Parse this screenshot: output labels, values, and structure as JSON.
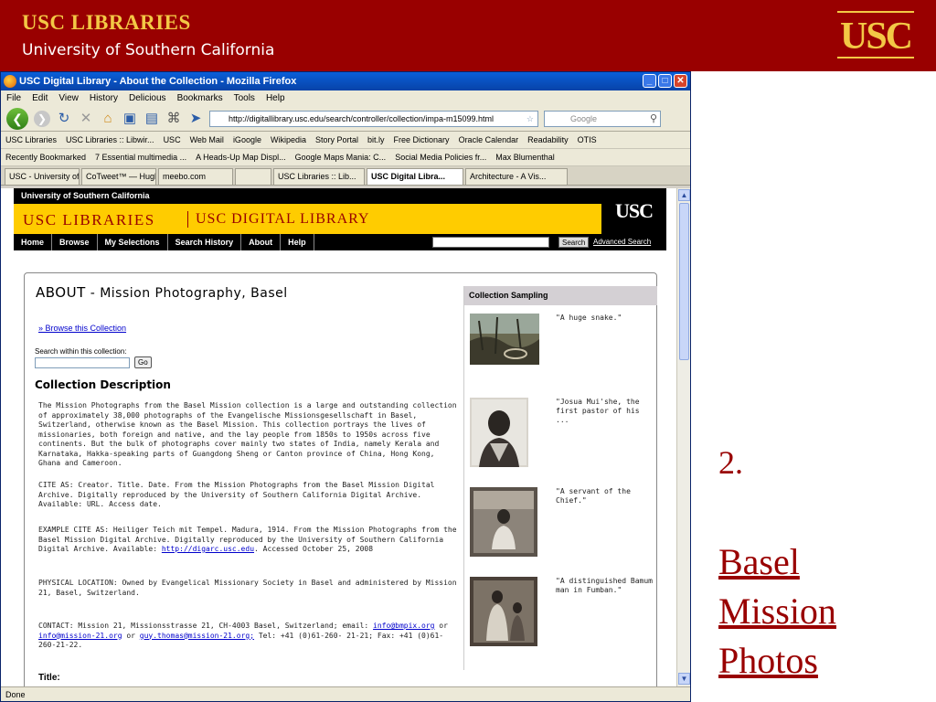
{
  "slide": {
    "brand_line1": "USC LIBRARIES",
    "brand_line2": "University of Southern California",
    "logo_text": "USC",
    "number": "2.",
    "link_lines": [
      "Basel",
      "Mission",
      "Photos"
    ]
  },
  "browser": {
    "title": "USC Digital Library - About the Collection - Mozilla Firefox",
    "menu": [
      "File",
      "Edit",
      "View",
      "History",
      "Delicious",
      "Bookmarks",
      "Tools",
      "Help"
    ],
    "url": "http://digitallibrary.usc.edu/search/controller/collection/impa-m15099.html",
    "search_placeholder": "Google",
    "bookmarks1": [
      "USC Libraries",
      "USC Libraries :: Libwir...",
      "USC",
      "Web Mail",
      "iGoogle",
      "Wikipedia",
      "Story Portal",
      "bit.ly",
      "Free Dictionary",
      "Oracle Calendar",
      "Readability",
      "OTIS"
    ],
    "bookmarks2": [
      "Recently Bookmarked",
      "7 Essential multimedia ...",
      "A Heads-Up Map Displ...",
      "Google Maps Mania: C...",
      "Social Media Policies fr...",
      "Max Blumenthal"
    ],
    "tabs": [
      "USC - University of ...",
      "CoTweet™ — Hugh...",
      "meebo.com",
      "",
      "USC Libraries :: Lib...",
      "USC Digital Libra...",
      "Architecture - A Vis..."
    ],
    "status": "Done"
  },
  "site": {
    "institution": "University of Southern California",
    "libraries": "USC LIBRARIES",
    "digital_library": "USC DIGITAL LIBRARY",
    "logo": "USC",
    "nav": [
      "Home",
      "Browse",
      "My Selections",
      "Search History",
      "About",
      "Help"
    ],
    "search_button": "Search",
    "advanced_search": "Advanced Search"
  },
  "page": {
    "about_caps": "ABOUT",
    "about_title": " - Mission Photography, Basel",
    "browse_link": "» Browse this Collection",
    "search_label": "Search within this collection:",
    "go": "Go",
    "description_heading": "Collection Description",
    "description": "The Mission Photographs from the Basel Mission collection is a large and outstanding collection of approximately 38,000 photographs of the Evangelische Missionsgesellschaft in Basel, Switzerland, otherwise known as the Basel Mission. This collection portrays the lives of missionaries, both foreign and native, and the lay people from 1850s to 1950s across five continents. But the bulk of photographs cover mainly two states of India, namely Kerala and Karnataka, Hakka-speaking parts of Guangdong Sheng or Canton province of China, Hong Kong, Ghana and Cameroon.",
    "cite_as": "CITE AS: Creator. Title. Date. From the Mission Photographs from the Basel Mission Digital Archive. Digitally reproduced by the University of Southern California Digital Archive. Available: URL. Access date.",
    "example_cite_prefix": "EXAMPLE CITE AS: Heiliger Teich mit Tempel. Madura, 1914. From the Mission Photographs from the Basel Mission Digital Archive. Digitally reproduced by the University of Southern California Digital Archive. Available: ",
    "example_cite_link": "http://digarc.usc.edu",
    "example_cite_suffix": ". Accessed October 25, 2008",
    "physical_location": "PHYSICAL LOCATION: Owned by Evangelical Missionary Society in Basel and administered by Mission 21, Basel, Switzerland.",
    "contact_prefix": "CONTACT: Mission 21, Missionsstrasse 21, CH-4003 Basel, Switzerland; email: ",
    "contact_email1": "info@bmpix.org",
    "contact_or1": " or ",
    "contact_email2": "info@mission-21.org",
    "contact_or2": " or ",
    "contact_email3": "guy.thomas@mission-21.org;",
    "contact_suffix": " Tel: +41 (0)61-260- 21-21; Fax: +41 (0)61-260-21-22.",
    "title_label": "Title:"
  },
  "sampling": {
    "heading": "Collection Sampling",
    "items": [
      {
        "caption": "\"A huge snake.\""
      },
      {
        "caption": "\"Josua Mui'she, the first pastor of his ..."
      },
      {
        "caption": "\"A servant of the Chief.\""
      },
      {
        "caption": "\"A distinguished Bamum man in Fumban.\""
      }
    ]
  },
  "colors": {
    "usc_cardinal": "#990000",
    "usc_gold": "#ffcc00"
  }
}
